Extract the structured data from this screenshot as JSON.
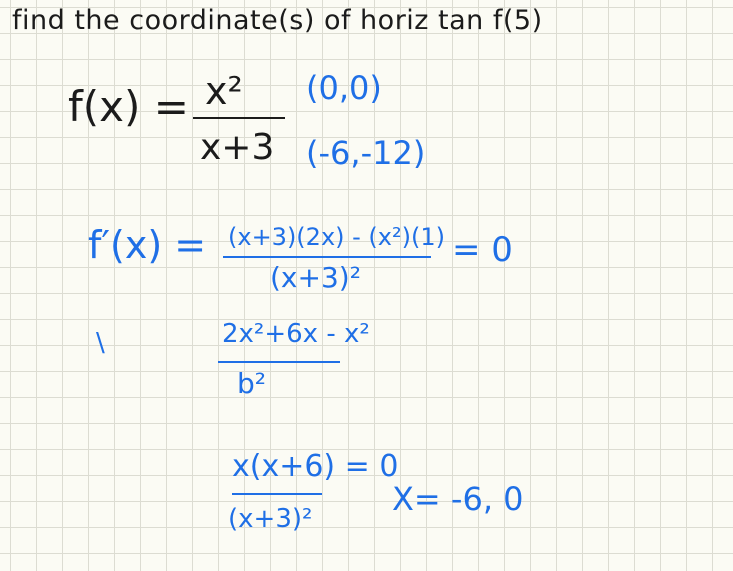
{
  "title": "find the coordinate(s) of horiz tan f(5)",
  "function": {
    "lhs": "f(x) =",
    "numerator": "x²",
    "denominator": "x+3",
    "points": [
      "(0,0)",
      "(-6,-12)"
    ]
  },
  "derivative": {
    "lhs": "f′(x) =",
    "numerator": "(x+3)(2x) - (x²)(1)",
    "denominator": "(x+3)²",
    "equals_zero": "= 0"
  },
  "stray_mark": "\\",
  "step2": {
    "numerator": "2x²+6x - x²",
    "denominator": "b²"
  },
  "step3": {
    "numerator": "x(x+6) = 0",
    "denominator": "(x+3)²",
    "solution": "X= -6, 0"
  },
  "colors": {
    "black_ink": "#1b1b1b",
    "blue_ink": "#1f6fe6",
    "paper": "#fbfbf4",
    "grid": "#dcdcd2"
  }
}
